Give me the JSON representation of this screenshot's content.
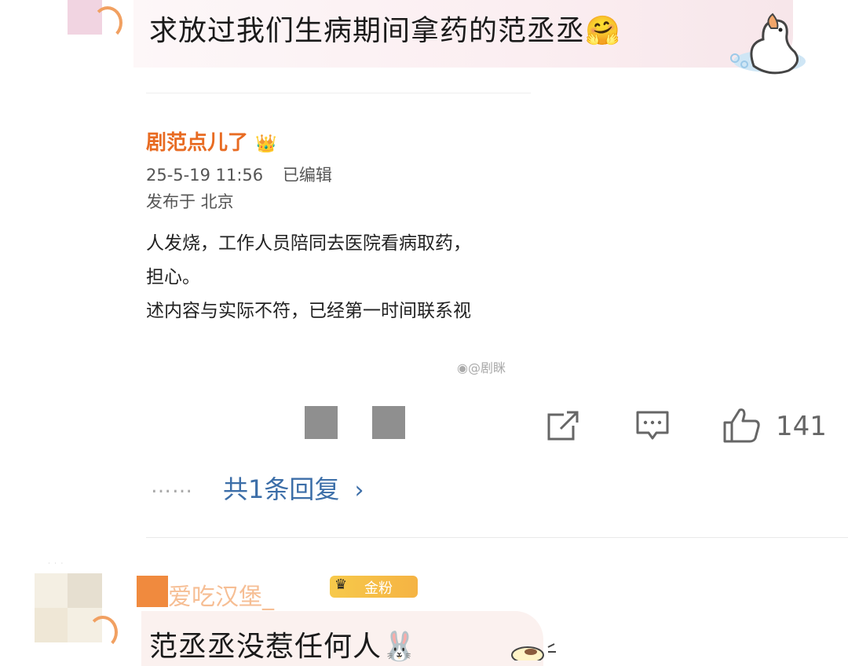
{
  "top_comment": {
    "text": "求放过我们生病期间拿药的范丞丞",
    "emoji": "🤗"
  },
  "embedded_post": {
    "author": "剧范点儿了",
    "timestamp": "25-5-19 11:56",
    "edited": "已编辑",
    "location": "发布于 北京",
    "body_lines": [
      "人发烧，工作人员陪同去医院看病取药，",
      "担心。",
      "述内容与实际不符，已经第一时间联系视"
    ],
    "watermark": "@剧眯"
  },
  "actions": {
    "share_icon": "share-icon",
    "comment_icon": "comment-icon",
    "like_icon": "thumbs-up-icon",
    "like_count": "141"
  },
  "replies": {
    "dots": "……",
    "link": "共1条回复",
    "chevron": "›"
  },
  "second_comment": {
    "username": "爱吃汉堡_",
    "badge": "金粉",
    "text": "范丞丞没惹任何人",
    "emoji": "🐰"
  },
  "colors": {
    "link": "#3c6ea8",
    "author": "#e86b22",
    "like": "#666666"
  }
}
